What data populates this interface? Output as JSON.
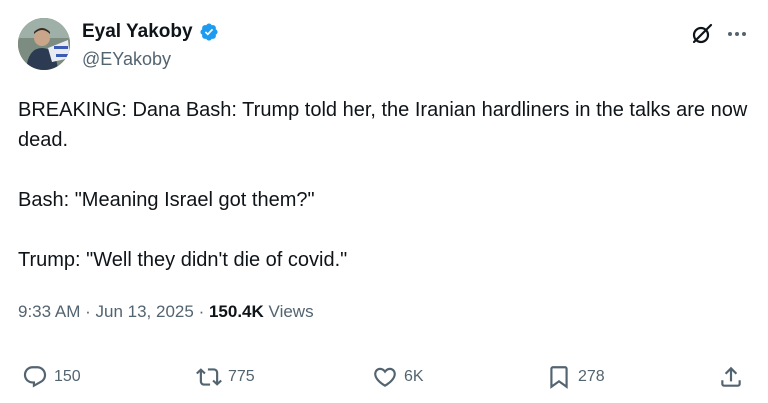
{
  "author": {
    "name": "Eyal Yakoby",
    "handle": "@EYakoby",
    "verified": true
  },
  "tweet": {
    "paragraphs": [
      "BREAKING: Dana Bash: Trump told her, the Iranian hardliners in the talks are now dead.",
      "Bash: \"Meaning Israel got them?\"",
      "Trump: \"Well they didn't die of covid.\""
    ],
    "time": "9:33 AM",
    "separator": "·",
    "date": "Jun 13, 2025",
    "views_count": "150.4K",
    "views_label": "Views"
  },
  "actions": {
    "replies": "150",
    "reposts": "775",
    "likes": "6K",
    "bookmarks": "278"
  },
  "colors": {
    "text": "#0f1419",
    "secondary": "#536471",
    "verified": "#1d9bf0"
  },
  "icons": [
    "verified-badge-icon",
    "grok-icon",
    "more-icon",
    "reply-icon",
    "repost-icon",
    "like-icon",
    "bookmark-icon",
    "share-icon"
  ]
}
